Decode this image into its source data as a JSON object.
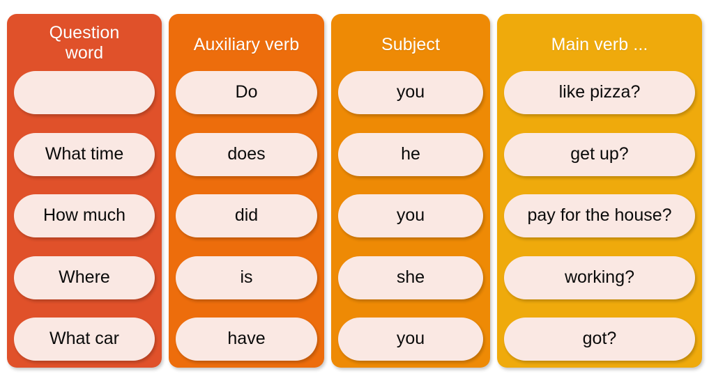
{
  "title": "Question word order table",
  "colors": {
    "column_question_word": "#E0512A",
    "column_auxiliary_verb": "#ED6D0C",
    "column_subject": "#EE8A05",
    "column_main_verb": "#EFAA0C",
    "pill_background": "#FAE8E3",
    "header_text": "#FFFFFF",
    "pill_text": "#0A0A0A",
    "page_background": "#FFFFFF"
  },
  "columns": [
    {
      "id": "question-word",
      "header": "Question word",
      "header_lines": [
        "Question",
        "word"
      ],
      "cells": [
        "",
        "What time",
        "How much",
        "Where",
        "What car"
      ]
    },
    {
      "id": "auxiliary-verb",
      "header": "Auxiliary verb",
      "header_lines": [
        "Auxiliary verb"
      ],
      "cells": [
        "Do",
        "does",
        "did",
        "is",
        "have"
      ]
    },
    {
      "id": "subject",
      "header": "Subject",
      "header_lines": [
        "Subject"
      ],
      "cells": [
        "you",
        "he",
        "you",
        "she",
        "you"
      ]
    },
    {
      "id": "main-verb",
      "header": "Main verb ...",
      "header_lines": [
        "Main verb ..."
      ],
      "cells": [
        "like pizza?",
        "get up?",
        "pay for the house?",
        "working?",
        "got?"
      ]
    }
  ]
}
